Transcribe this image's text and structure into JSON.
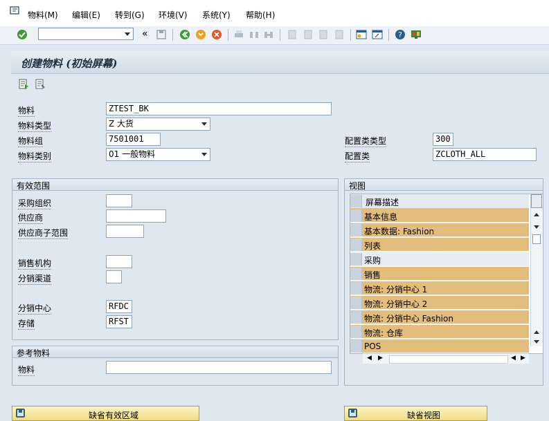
{
  "menu": {
    "items": [
      "物料(M)",
      "编辑(E)",
      "转到(G)",
      "环境(V)",
      "系统(Y)",
      "帮助(H)"
    ]
  },
  "toolbar": {
    "command_value": "",
    "back_label": "«"
  },
  "title": "创建物料 (初始屏幕)",
  "fields": {
    "material_label": "物料",
    "material_value": "ZTEST_BK",
    "material_type_label": "物料类型",
    "material_type_value": "Z          大货",
    "material_group_label": "物料组",
    "material_group_value": "7501001",
    "material_category_label": "物料类别",
    "material_category_value": "01 一般物料",
    "config_class_type_label": "配置类类型",
    "config_class_type_value": "300",
    "config_class_label": "配置类",
    "config_class_value": "ZCLOTH_ALL"
  },
  "org_levels": {
    "header": "有效范围",
    "purch_org_label": "采购组织",
    "purch_org_value": "",
    "vendor_label": "供应商",
    "vendor_value": "",
    "vendor_subrange_label": "供应商子范围",
    "vendor_subrange_value": "",
    "sales_org_label": "销售机构",
    "sales_org_value": "",
    "distr_channel_label": "分销渠道",
    "distr_channel_value": "",
    "dc_label": "分销中心",
    "dc_value": "RFDC",
    "storage_label": "存储",
    "storage_value": "RFST"
  },
  "reference": {
    "header": "参考物料",
    "material_label": "物料",
    "material_value": ""
  },
  "views": {
    "header": "视图",
    "column_header": "屏幕描述",
    "rows": [
      {
        "label": "基本信息",
        "selected": true
      },
      {
        "label": "基本数据: Fashion",
        "selected": true
      },
      {
        "label": "列表",
        "selected": true
      },
      {
        "label": "采购",
        "selected": false
      },
      {
        "label": "销售",
        "selected": true
      },
      {
        "label": "物流: 分销中心 1",
        "selected": true
      },
      {
        "label": "物流: 分销中心 2",
        "selected": true
      },
      {
        "label": "物流: 分销中心 Fashion",
        "selected": true
      },
      {
        "label": "物流: 仓库",
        "selected": true
      },
      {
        "label": "POS",
        "selected": true
      }
    ]
  },
  "buttons": {
    "default_org_levels": "缺省有效区域",
    "default_views": "缺省视图"
  },
  "colors": {
    "selected_row": "#e3bd7c",
    "background": "#dfe8f1"
  }
}
